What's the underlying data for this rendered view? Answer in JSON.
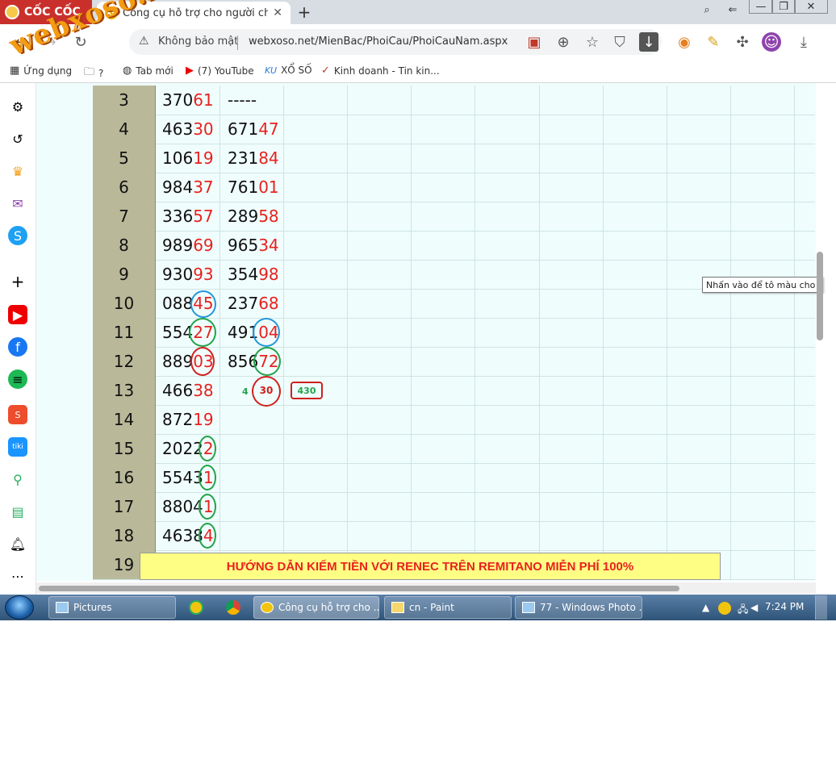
{
  "browser": {
    "brand": "CỐC CỐC",
    "tab_title": "Công cụ hỗ trợ cho người ch",
    "tab_favicon": "XS",
    "new_tab": "+",
    "insecure_label": "Không bảo mật",
    "url": "webxoso.net/MienBac/PhoiCau/PhoiCauNam.aspx",
    "watermark": "webxoso.net",
    "bookmarks": [
      {
        "label": "Ứng dụng",
        "icon": "apps-icon"
      },
      {
        "label": "?",
        "icon": "folder-icon"
      },
      {
        "label": "Tab mới",
        "icon": "globe-icon"
      },
      {
        "label": "(7) YouTube",
        "icon": "youtube-icon"
      },
      {
        "label": "XỔ SỐ",
        "icon": "ku-icon"
      },
      {
        "label": "Kinh doanh - Tin kin...",
        "icon": "check-icon"
      }
    ]
  },
  "table": {
    "rows": [
      {
        "n": "3",
        "c1a": "370",
        "c1b": "61",
        "c2a": "-----",
        "c2b": ""
      },
      {
        "n": "4",
        "c1a": "463",
        "c1b": "30",
        "c2a": "671",
        "c2b": "47"
      },
      {
        "n": "5",
        "c1a": "106",
        "c1b": "19",
        "c2a": "231",
        "c2b": "84"
      },
      {
        "n": "6",
        "c1a": "984",
        "c1b": "37",
        "c2a": "761",
        "c2b": "01"
      },
      {
        "n": "7",
        "c1a": "336",
        "c1b": "57",
        "c2a": "289",
        "c2b": "58"
      },
      {
        "n": "8",
        "c1a": "989",
        "c1b": "69",
        "c2a": "965",
        "c2b": "34"
      },
      {
        "n": "9",
        "c1a": "930",
        "c1b": "93",
        "c2a": "354",
        "c2b": "98"
      },
      {
        "n": "10",
        "c1a": "088",
        "c1b": "45",
        "c2a": "237",
        "c2b": "68"
      },
      {
        "n": "11",
        "c1a": "554",
        "c1b": "27",
        "c2a": "491",
        "c2b": "04"
      },
      {
        "n": "12",
        "c1a": "889",
        "c1b": "03",
        "c2a": "856",
        "c2b": "72"
      },
      {
        "n": "13",
        "c1a": "466",
        "c1b": "38",
        "c2a": "",
        "c2b": ""
      },
      {
        "n": "14",
        "c1a": "872",
        "c1b": "19",
        "c2a": "",
        "c2b": ""
      },
      {
        "n": "15",
        "c1a": "2022",
        "c1b": "2",
        "c2a": "",
        "c2b": ""
      },
      {
        "n": "16",
        "c1a": "5543",
        "c1b": "1",
        "c2a": "",
        "c2b": ""
      },
      {
        "n": "17",
        "c1a": "8804",
        "c1b": "1",
        "c2a": "",
        "c2b": ""
      },
      {
        "n": "18",
        "c1a": "4638",
        "c1b": "4",
        "c2a": "",
        "c2b": ""
      },
      {
        "n": "19",
        "c1a": "",
        "c1b": "",
        "c2a": "",
        "c2b": ""
      }
    ],
    "annotation_small": "4",
    "annotation_circled": "30",
    "annotation_box": "430"
  },
  "tooltip": "Nhấn vào để tô màu cho ô",
  "banner": "HƯỚNG DẪN KIẾM TIỀN VỚI RENEC TRÊN REMITANO MIỄN PHÍ 100%",
  "taskbar": {
    "items": [
      {
        "label": "Pictures"
      },
      {
        "label": "Công cụ hỗ trợ cho ..."
      },
      {
        "label": "cn - Paint"
      },
      {
        "label": "77 - Windows Photo ..."
      }
    ],
    "clock": "7:24 PM"
  },
  "colors": {
    "red_digits": "#e8221e",
    "row_number_bg": "#b9b99a",
    "content_bg": "#f0fdfd",
    "banner_bg": "#fefe84"
  }
}
